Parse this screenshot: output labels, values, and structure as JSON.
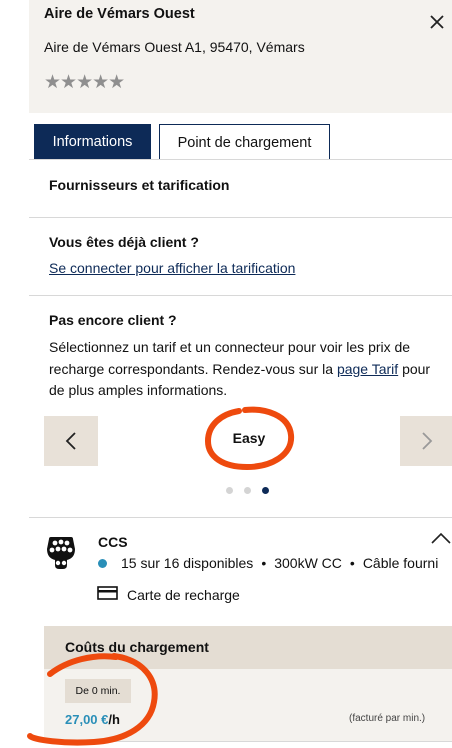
{
  "station": {
    "name": "Aire de Vémars Ouest",
    "address": "Aire de Vémars Ouest A1, 95470, Vémars",
    "rating_stars": "★★★★★",
    "rating": 0
  },
  "tabs": {
    "informations": "Informations",
    "point": "Point de chargement"
  },
  "sections": {
    "providers_title": "Fournisseurs et tarification",
    "client_title": "Vous êtes déjà client ?",
    "client_link": "Se connecter pour afficher la tarification",
    "not_client_title": "Pas encore client ?",
    "not_client_text": "Sélectionnez un tarif et un connecteur pour voir les prix de recharge correspondants. Rendez-vous sur la",
    "not_client_link": "page Tarif",
    "not_client_text_end": "pour de plus amples informations."
  },
  "carousel": {
    "current_tariff": "Easy",
    "pages": 3,
    "active_page": 3
  },
  "connector": {
    "type": "CCS",
    "availability": "15 sur 16 disponibles",
    "power": "300kW CC",
    "cable": "Câble fourni",
    "payment": "Carte de recharge",
    "status_color": "#2a8fb8"
  },
  "costs": {
    "title": "Coûts du chargement",
    "from_label": "De 0 min.",
    "price": "27,00 €",
    "unit": "/h",
    "billing": "(facturé par min.)"
  },
  "colors": {
    "primary": "#0d2a57",
    "accent": "#2a8fb8",
    "annotation": "#ee4a0e",
    "panel": "#f4f2ee",
    "beige": "#e4ddd3"
  }
}
